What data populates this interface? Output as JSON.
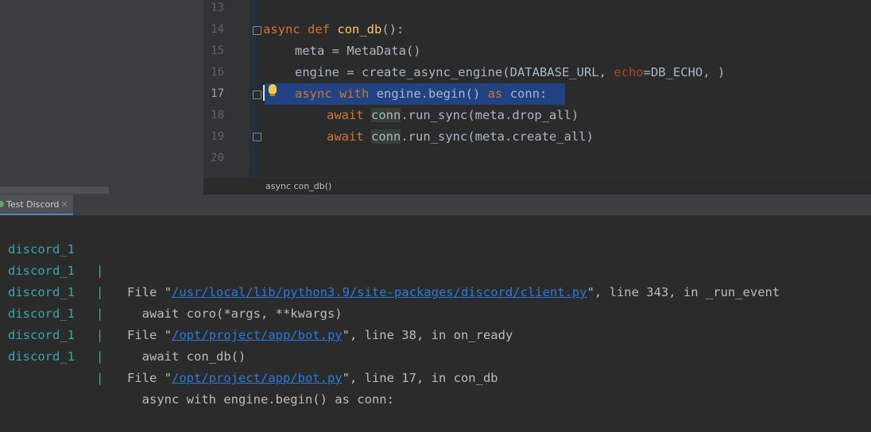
{
  "editor": {
    "line_numbers": [
      "13",
      "14",
      "15",
      "16",
      "17",
      "18",
      "19",
      "20"
    ],
    "lines": {
      "l14": {
        "kw1": "async",
        "kw2": "def",
        "fn": "con_db",
        "rest": "():"
      },
      "l15": {
        "text": "meta = MetaData()"
      },
      "l16": {
        "pre": "engine = create_async_engine(DATABASE_URL, ",
        "param": "echo",
        "mid": "=DB_ECHO, ",
        "close": ")"
      },
      "l17": {
        "kw1": "async",
        "kw2": "with",
        "mid": "engine.begin()",
        "kw3": "as",
        "end": "conn:"
      },
      "l18": {
        "kw": "await",
        "conn": "conn",
        "rest": ".run_sync(meta.drop_all)"
      },
      "l19": {
        "kw": "await",
        "conn": "conn",
        "rest": ".run_sync(meta.create_all)"
      }
    },
    "breadcrumb": "async con_db()"
  },
  "run_tab": {
    "label": "Test Discord",
    "close": "×"
  },
  "console": {
    "service": "discord_1",
    "pipe": "|",
    "lines": [
      {
        "pre": "File \"",
        "link": "/usr/local/lib/python3.9/site-packages/discord/client.py",
        "post": "\", line 343, in _run_event"
      },
      {
        "text": "  await coro(*args, **kwargs)"
      },
      {
        "pre": "File \"",
        "link": "/opt/project/app/bot.py",
        "post": "\", line 38, in on_ready"
      },
      {
        "text": "  await con_db()"
      },
      {
        "pre": "File \"",
        "link": "/opt/project/app/bot.py",
        "post": "\", line 17, in con_db"
      },
      {
        "text": "  async with engine.begin() as conn:"
      }
    ]
  },
  "colors": {
    "keyword": "#cc7832",
    "function": "#ffc66d",
    "service": "#3aa6a8",
    "link": "#287bde",
    "selection": "#214283"
  }
}
